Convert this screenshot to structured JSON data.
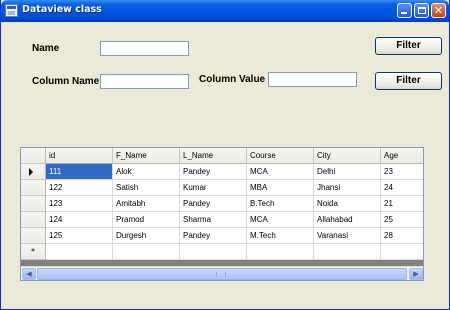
{
  "window": {
    "title": "Dataview class"
  },
  "form": {
    "name_label": "Name",
    "name_value": "",
    "column_name_label": "Column Name",
    "column_name_value": "",
    "column_value_label": "Column Value",
    "column_value_value": "",
    "filter_button_1": "Filter",
    "filter_button_2": "Filter"
  },
  "grid": {
    "columns": [
      "id",
      "F_Name",
      "L_Name",
      "Course",
      "City",
      "Age"
    ],
    "rows": [
      [
        "111",
        "Alok",
        "Pandey",
        "MCA",
        "Delhi",
        "23"
      ],
      [
        "122",
        "Satish",
        "Kumar",
        "MBA",
        "Jhansi",
        "24"
      ],
      [
        "123",
        "Amitabh",
        "Pandey",
        "B.Tech",
        "Noida",
        "21"
      ],
      [
        "124",
        "Pramod",
        "Sharma",
        "MCA",
        "Allahabad",
        "25"
      ],
      [
        "125",
        "Durgesh",
        "Pandey",
        "M.Tech",
        "Varanasi",
        "28"
      ]
    ],
    "new_row_marker": "*",
    "selected_cell": "111"
  },
  "colors": {
    "selection": "#316ac5",
    "titlebar": "#0055e5"
  }
}
